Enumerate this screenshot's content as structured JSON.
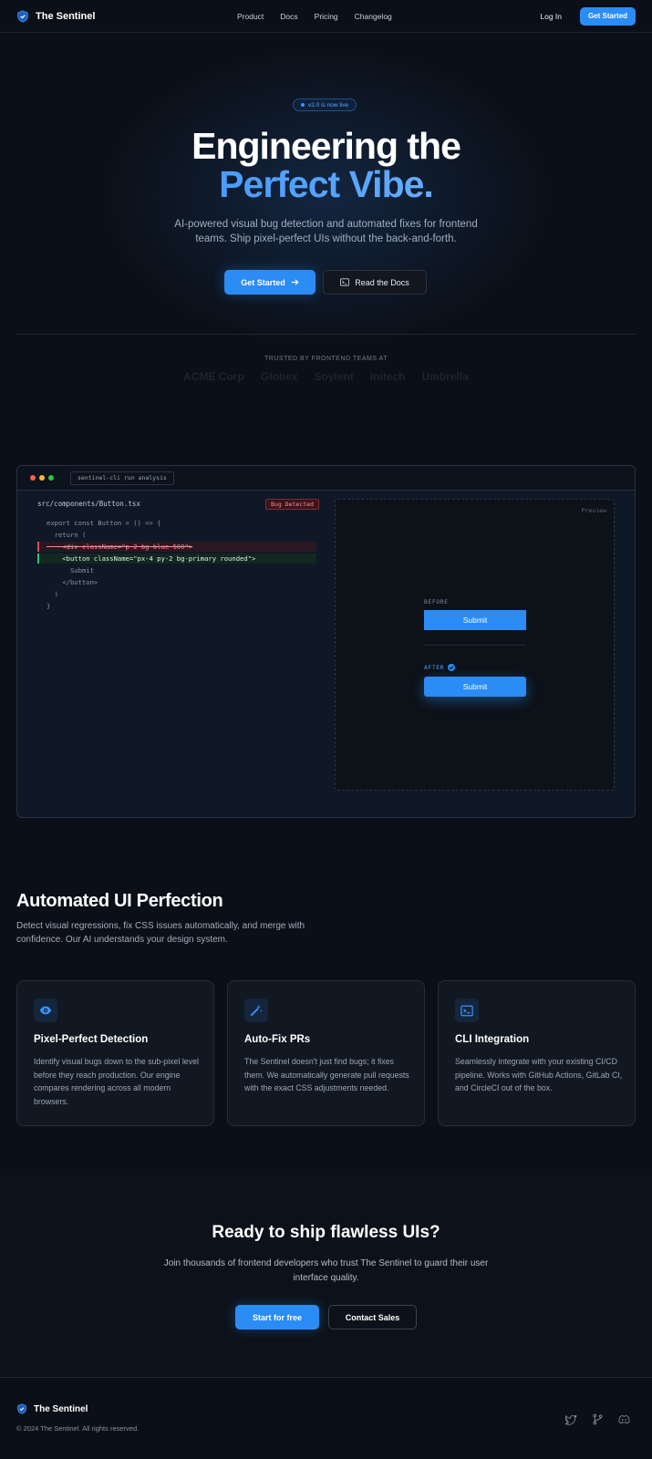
{
  "colors": {
    "accent": "#2b8cf5",
    "background": "#0b0f17"
  },
  "nav": {
    "brand": "The Sentinel",
    "links": [
      "Product",
      "Docs",
      "Pricing",
      "Changelog"
    ],
    "login": "Log In",
    "cta": "Get Started"
  },
  "hero": {
    "badge": "v2.0 is now live",
    "title_line1": "Engineering the",
    "title_line2": "Perfect Vibe.",
    "subtitle": "AI-powered visual bug detection and automated fixes for frontend teams. Ship pixel-perfect UIs without the back-and-forth.",
    "primary_button": "Get Started",
    "secondary_button": "Read the Docs",
    "trusted_label": "TRUSTED BY FRONTEND TEAMS AT",
    "logos": [
      "ACME Corp",
      "Globex",
      "Soylent",
      "Initech",
      "Umbrella"
    ]
  },
  "demo": {
    "command": "sentinel-cli run analysis",
    "filename": "src/components/Button.tsx",
    "bug_badge": "Bug Detected",
    "code": [
      "export const Button = () => {",
      "  return (",
      "    <div className=\"p-2 bg-blue-500\">",
      "    <button className=\"px-4 py-2 bg-primary rounded\">",
      "      Submit",
      "    </button>",
      "  )",
      "}"
    ],
    "preview_label": "Preview",
    "before_label": "BEFORE",
    "after_label": "AFTER",
    "before_button": "Submit",
    "after_button": "Submit"
  },
  "features": {
    "title": "Automated UI Perfection",
    "subtitle": "Detect visual regressions, fix CSS issues automatically, and merge with confidence. Our AI understands your design system.",
    "cards": [
      {
        "icon": "eye-icon",
        "title": "Pixel-Perfect Detection",
        "text": "Identify visual bugs down to the sub-pixel level before they reach production. Our engine compares rendering across all modern browsers."
      },
      {
        "icon": "magic-wand-icon",
        "title": "Auto-Fix PRs",
        "text": "The Sentinel doesn't just find bugs; it fixes them. We automatically generate pull requests with the exact CSS adjustments needed."
      },
      {
        "icon": "terminal-icon",
        "title": "CLI Integration",
        "text": "Seamlessly integrate with your existing CI/CD pipeline. Works with GitHub Actions, GitLab CI, and CircleCI out of the box."
      }
    ]
  },
  "cta": {
    "title": "Ready to ship flawless UIs?",
    "subtitle": "Join thousands of frontend developers who trust The Sentinel to guard their user interface quality.",
    "primary": "Start for free",
    "secondary": "Contact Sales"
  },
  "footer": {
    "brand": "The Sentinel",
    "copyright": "© 2024 The Sentinel. All rights reserved.",
    "socials": [
      "twitter-icon",
      "git-branch-icon",
      "discord-icon"
    ]
  }
}
